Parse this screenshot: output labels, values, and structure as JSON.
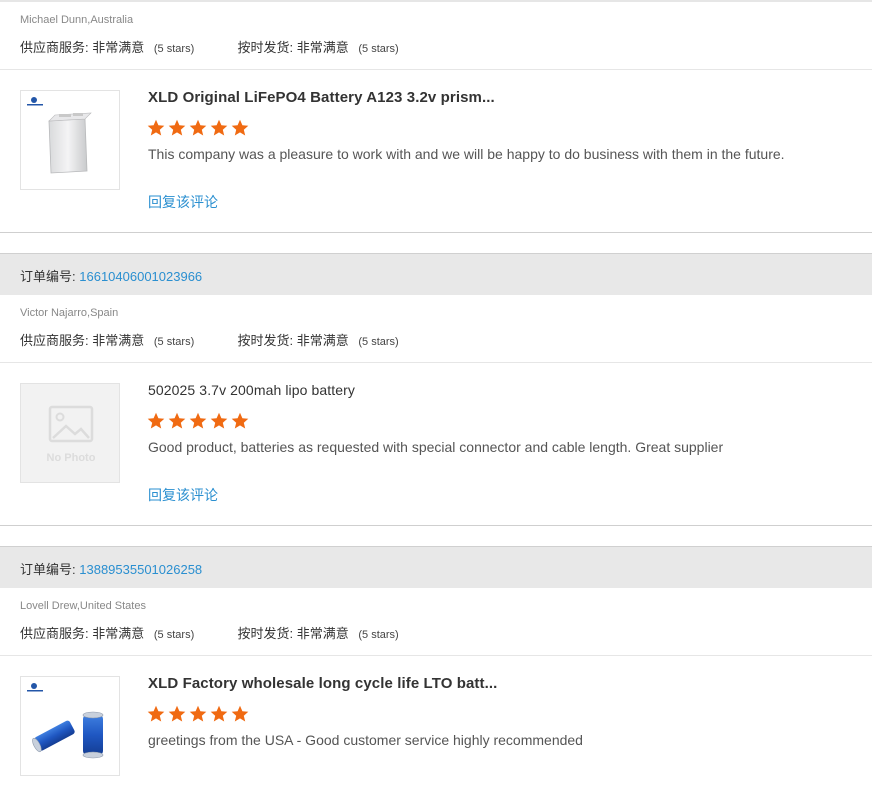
{
  "colors": {
    "accent_blue": "#2a8fd0",
    "star_orange": "#f06a12",
    "order_bar_bg": "#e8e8e8"
  },
  "labels": {
    "order_number": "订单编号:",
    "supplier_service": "供应商服务:",
    "on_time_shipping": "按时发货:",
    "reply": "回复该评论"
  },
  "reviews": [
    {
      "reviewer": "Michael Dunn,Australia",
      "supplier_service_value": "非常满意",
      "supplier_service_stars": "(5 stars)",
      "on_time_value": "非常满意",
      "on_time_stars": "(5 stars)",
      "product_title": "XLD Original LiFePO4 Battery A123 3.2v prism...",
      "rating": 5,
      "text": "This company was a pleasure to work with and we will be happy to do business with them in the future.",
      "image": "prismatic-battery-icon"
    },
    {
      "order_number": "16610406001023966",
      "reviewer": "Victor Najarro,Spain",
      "supplier_service_value": "非常满意",
      "supplier_service_stars": "(5 stars)",
      "on_time_value": "非常满意",
      "on_time_stars": "(5 stars)",
      "product_title": "502025 3.7v 200mah lipo battery",
      "rating": 5,
      "text": "Good product, batteries as requested with special connector and cable length. Great supplier",
      "image": "no-photo-icon",
      "no_photo_label": "No Photo"
    },
    {
      "order_number": "13889535501026258",
      "reviewer": "Lovell Drew,United States",
      "supplier_service_value": "非常满意",
      "supplier_service_stars": "(5 stars)",
      "on_time_value": "非常满意",
      "on_time_stars": "(5 stars)",
      "product_title": "XLD Factory wholesale long cycle life LTO batt...",
      "rating": 5,
      "text": "greetings from the USA - Good customer service highly recommended",
      "image": "cylindrical-battery-icon"
    }
  ]
}
